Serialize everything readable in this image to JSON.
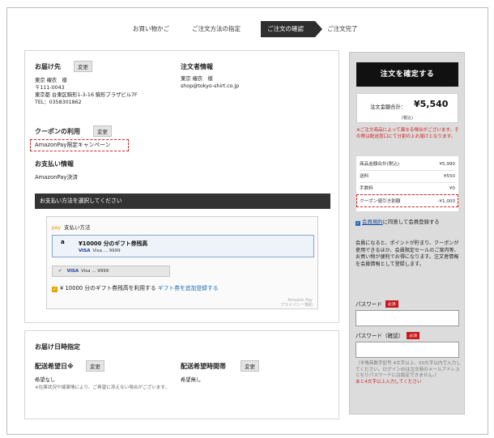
{
  "steps": [
    {
      "label": "お買い物かご"
    },
    {
      "label": "ご注文方法の指定"
    },
    {
      "label": "ご注文の確認"
    },
    {
      "label": "ご注文完了"
    }
  ],
  "delivery": {
    "title": "お届け先",
    "change_label": "変更",
    "name": "東京 襯衣　様",
    "postal": "〒111-0043",
    "address": "東京都 台東区駒形1-3-16 駒形プラザビル7F",
    "tel": "TEL：0358301862"
  },
  "orderer": {
    "title": "注文者情報",
    "name": "東京 襯衣　様",
    "email": "shop@tokyo-shirt.co.jp"
  },
  "coupon": {
    "title": "クーポンの利用",
    "change_label": "変更",
    "value": "AmazonPay限定キャンペーン"
  },
  "payment": {
    "title": "お支払い情報",
    "method": "AmazonPay決済",
    "bar_label": "お支払い方法を選択してください",
    "pay_logo": "pay",
    "widget_title": "支払い方法",
    "gift_logo": "a",
    "gift_title": "¥10000 分のギフト券残高",
    "gift_card": "Visa ... 9999",
    "card2_check": "✔",
    "card2_brand": "VISA",
    "card2_label": "Visa ... 9999",
    "visa_mark": "VISA",
    "use_gift_check": "✓",
    "use_gift_text": "¥ 10000 分のギフト券残高を利用する",
    "add_gift_link": "ギフト券を追加登録する",
    "amazon_pay_label": "Amazon Pay",
    "privacy_label": "プライバシー規約"
  },
  "schedule": {
    "title": "お届け日時指定",
    "date_title": "配送希望日※",
    "date_change_label": "変更",
    "date_value": "希望なし",
    "date_note": "※在庫状況や諸事情により、ご希望に添えない場合がございます。",
    "time_title": "配送希望時間帯",
    "time_change_label": "変更",
    "time_value": "希望無し"
  },
  "sidebar": {
    "confirm_label": "注文を確定する",
    "hand_icon": "☝",
    "total_label": "注文金額合計：",
    "total_amount": "¥5,540",
    "tax_label": "(税込)",
    "notice": "※ご注文商品によって異なる場合がございます。その際は配送窓口にて分割の上お届けとなります。",
    "rows": [
      {
        "label": "商品金額合計(税込)",
        "value": "¥5,990"
      },
      {
        "label": "送料",
        "value": "¥550"
      },
      {
        "label": "手数料",
        "value": "¥0"
      },
      {
        "label": "クーポン値引き割額",
        "value": "-¥1,000"
      }
    ],
    "agree_check": "✓",
    "agree_link": "会員規約",
    "agree_text": "に同意して会員登録する",
    "benefit": "会員になると、ポイントが貯まり、クーポンが使用できるほか、会員限定セールのご案内等、お買い物が便利でお得になります。注文者情報を会員情報として登録します。",
    "password_label": "パスワード",
    "password_confirm_label": "パスワード（確認）",
    "required_label": "必須",
    "password_hint": "（半角英数字記号 4文字以上、50文字以内で入力してください。ログインIDは注文時のメールアドレスとなりパスワードには設定できません。）",
    "password_hint_red": "あと4文字以上入力してください"
  }
}
